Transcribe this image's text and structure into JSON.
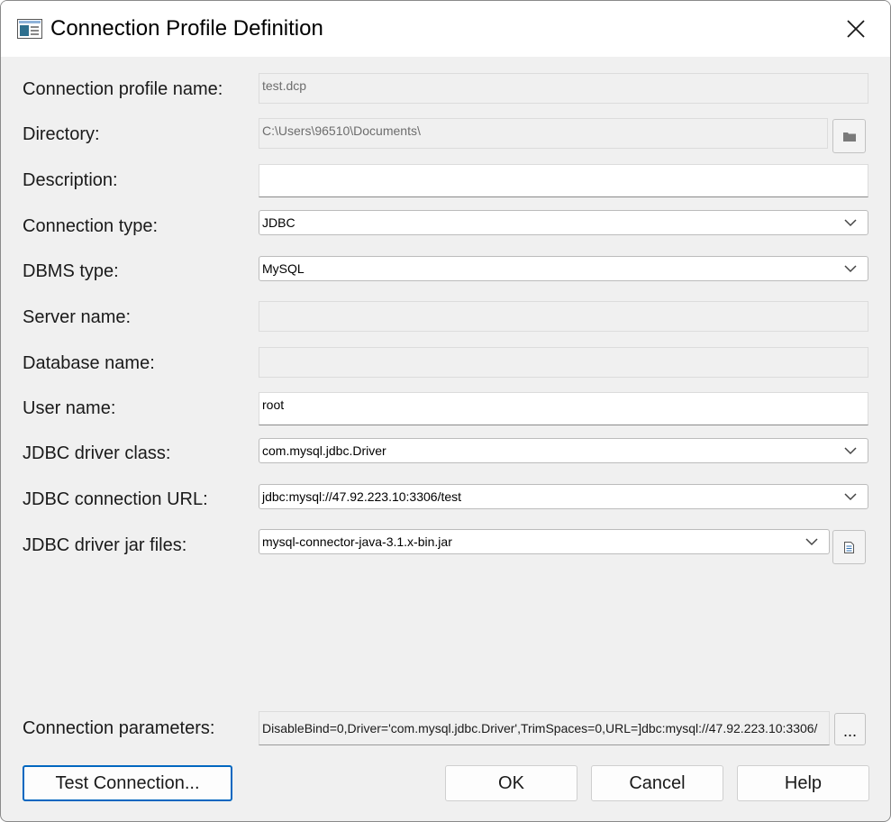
{
  "window": {
    "title": "Connection Profile Definition"
  },
  "fields": {
    "profile_name": {
      "label": "Connection profile name:",
      "value": "test.dcp"
    },
    "directory": {
      "label": "Directory:",
      "value": "C:\\Users\\96510\\Documents\\"
    },
    "description": {
      "label": "Description:",
      "value": ""
    },
    "connection_type": {
      "label": "Connection type:",
      "value": "JDBC"
    },
    "dbms_type": {
      "label": "DBMS type:",
      "value": "MySQL"
    },
    "server_name": {
      "label": "Server name:",
      "value": ""
    },
    "database_name": {
      "label": "Database name:",
      "value": ""
    },
    "user_name": {
      "label": "User name:",
      "value": "root"
    },
    "jdbc_driver_class": {
      "label": "JDBC driver class:",
      "value": "com.mysql.jdbc.Driver"
    },
    "jdbc_url": {
      "label": "JDBC connection URL:",
      "value": "jdbc:mysql://47.92.223.10:3306/test"
    },
    "jdbc_jar": {
      "label": "JDBC driver jar files:",
      "value": "mysql-connector-java-3.1.x-bin.jar"
    },
    "connection_parameters": {
      "label": "Connection parameters:",
      "value": "DisableBind=0,Driver='com.mysql.jdbc.Driver',TrimSpaces=0,URL=]dbc:mysql://47.92.223.10:3306/"
    }
  },
  "buttons": {
    "ellipsis": "...",
    "test_connection": "Test Connection...",
    "ok": "OK",
    "cancel": "Cancel",
    "help": "Help"
  },
  "icons": {
    "app": "window-app-icon",
    "close": "close-icon",
    "folder": "folder-icon",
    "file": "file-icon",
    "chevron": "chevron-down-icon"
  },
  "colors": {
    "dialog_bg": "#f0f0f0",
    "accent": "#0067c0"
  }
}
